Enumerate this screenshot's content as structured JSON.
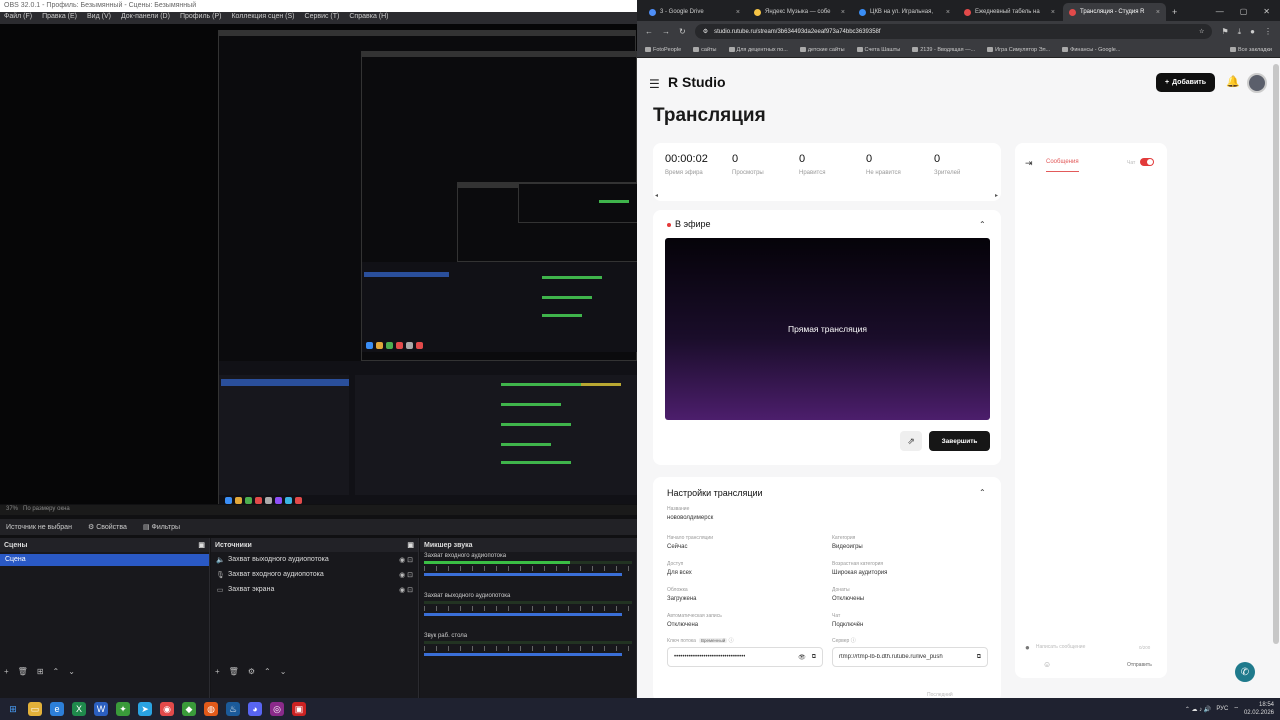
{
  "obs": {
    "title": "OBS 32.0.1 - Профиль: Безымянный - Сцены: Безымянный",
    "menu": [
      "Файл (F)",
      "Правка (E)",
      "Вид (V)",
      "Док-панели (D)",
      "Профиль (P)",
      "Коллекция сцен (S)",
      "Сервис (T)",
      "Справка (H)"
    ],
    "zoom_status": "37%",
    "zoom_mode": "По размеру окна",
    "no_source": "Источник не выбран",
    "properties_btn": "Свойства",
    "filters_btn": "Фильтры",
    "scenes_title": "Сцены",
    "scene_item": "Сцена",
    "sources_title": "Источники",
    "sources": [
      {
        "name": "Захват выходного аудиопотока",
        "icon": "speaker-icon"
      },
      {
        "name": "Захват входного аудиопотока",
        "icon": "mic-icon"
      },
      {
        "name": "Захват экрана",
        "icon": "monitor-icon"
      }
    ],
    "mixer_title": "Микшер звука",
    "mixer": [
      {
        "name": "Захват входного аудиопотока",
        "level": 0.7
      },
      {
        "name": "Захват выходного аудиопотока",
        "level": 0.0
      },
      {
        "name": "Звук раб. стола",
        "level": 0.0
      }
    ]
  },
  "browser": {
    "tabs": [
      {
        "title": "3 - Google Drive",
        "color": "#4e8ef7"
      },
      {
        "title": "Яндекс Музыка — собе",
        "color": "#f6c445"
      },
      {
        "title": "ЦКВ на ул. Игральная,",
        "color": "#3a8ef6"
      },
      {
        "title": "Ежедневный табель на",
        "color": "#e24a4a"
      },
      {
        "title": "Трансляция - Студия R",
        "color": "#e24a4a"
      }
    ],
    "url": "studio.rutube.ru/stream/3b634493da2eeaf973a74bbc3639358f",
    "bookmarks": [
      "FotoPeople",
      "сайты",
      "Для децентных по...",
      "детские сайты",
      "Счета Шашты",
      "2139 - Вводящая —...",
      "Игра Симулятор Эл...",
      "Финансы - Google...",
      "Все закладки"
    ]
  },
  "studio": {
    "logo": "R Studio",
    "add_button": "Добавить",
    "page_title": "Трансляция",
    "stats": [
      {
        "value": "00:00:02",
        "label": "Время эфира"
      },
      {
        "value": "0",
        "label": "Просмотры"
      },
      {
        "value": "0",
        "label": "Нравится"
      },
      {
        "value": "0",
        "label": "Не нравится"
      },
      {
        "value": "0",
        "label": "Зрителей"
      }
    ],
    "live_header": "В эфире",
    "video_label": "Прямая трансляция",
    "finish_button": "Завершить",
    "settings_header": "Настройки трансляции",
    "fields": {
      "name": {
        "label": "Название",
        "value": "нововолдимерск"
      },
      "start": {
        "label": "Начало трансляции",
        "value": "Сейчас"
      },
      "category": {
        "label": "Категория",
        "value": "Видеоигры"
      },
      "access": {
        "label": "Доступ",
        "value": "Для всех"
      },
      "age": {
        "label": "Возрастная категория",
        "value": "Широкая аудитория"
      },
      "cover": {
        "label": "Обложка",
        "value": "Загружена"
      },
      "donate": {
        "label": "Донаты",
        "value": "Отключены"
      },
      "autorec": {
        "label": "Автоматическая запись",
        "value": "Отключена"
      },
      "chatf": {
        "label": "Чат",
        "value": "Подключён"
      },
      "key": {
        "label": "Ключ потока",
        "badge": "Временный",
        "value": "••••••••••••••••••••••••••••••••••"
      },
      "server": {
        "label": "Сервер",
        "value": "rtmp://rtmp-lb-b.dth.rutube.ru/live_push"
      }
    },
    "chat": {
      "tab": "Сообщения",
      "chat_label": "Чат",
      "placeholder": "Написать сообщение",
      "counter": "0/200",
      "send": "Отправить"
    },
    "bottom_hint": "Последний"
  },
  "taskbar": {
    "lang": "РУС",
    "time": "18:54",
    "date": "02.02.2026"
  }
}
